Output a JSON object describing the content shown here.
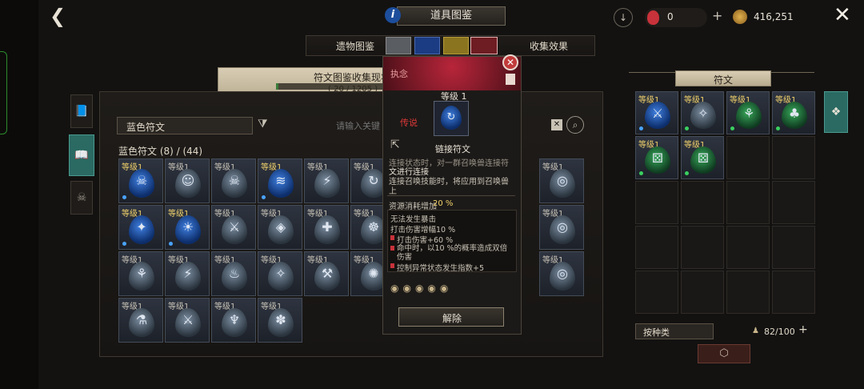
{
  "header": {
    "title": "道具图鉴",
    "info_icon": "info-icon",
    "red_gem_count": "0",
    "plus": "+",
    "gold_count": "416,251"
  },
  "tabs": {
    "relic": "遗物图鉴",
    "collect": "收集效果"
  },
  "banner": {
    "title": "符文图鉴收集现状",
    "progress": "( 20 / 1205 )"
  },
  "filter": {
    "dropdown": "蓝色符文",
    "search_placeholder": "请输入关键"
  },
  "list": {
    "section": "蓝色符文 (8) / (44)",
    "level": "等级1"
  },
  "popup": {
    "tag": "执念",
    "level": "等级 1",
    "grade": "传说",
    "name": "链接符文",
    "desc1": "连接状态时，对一群召唤兽连接符",
    "desc2": "文进行连接",
    "desc3": "连接召唤技能时，将应用到召唤兽",
    "desc4": "上",
    "cost_label": "资源消耗增加",
    "cost_value": "20 %",
    "stats": [
      "无法发生暴击",
      "打击伤害增幅10 %",
      "打击伤害+60 %",
      "命中时，以10 %的概率造成双倍伤害",
      "控制异常状态发生指数+5"
    ],
    "release": "解除"
  },
  "right": {
    "title": "符文",
    "level": "等级1",
    "sort": "按种类",
    "capacity": "82/100",
    "plus": "+"
  },
  "colors": {
    "gold": "#f2d26b",
    "red": "#c8323a",
    "blue": "#3f7fe0",
    "green": "#38a85a"
  }
}
